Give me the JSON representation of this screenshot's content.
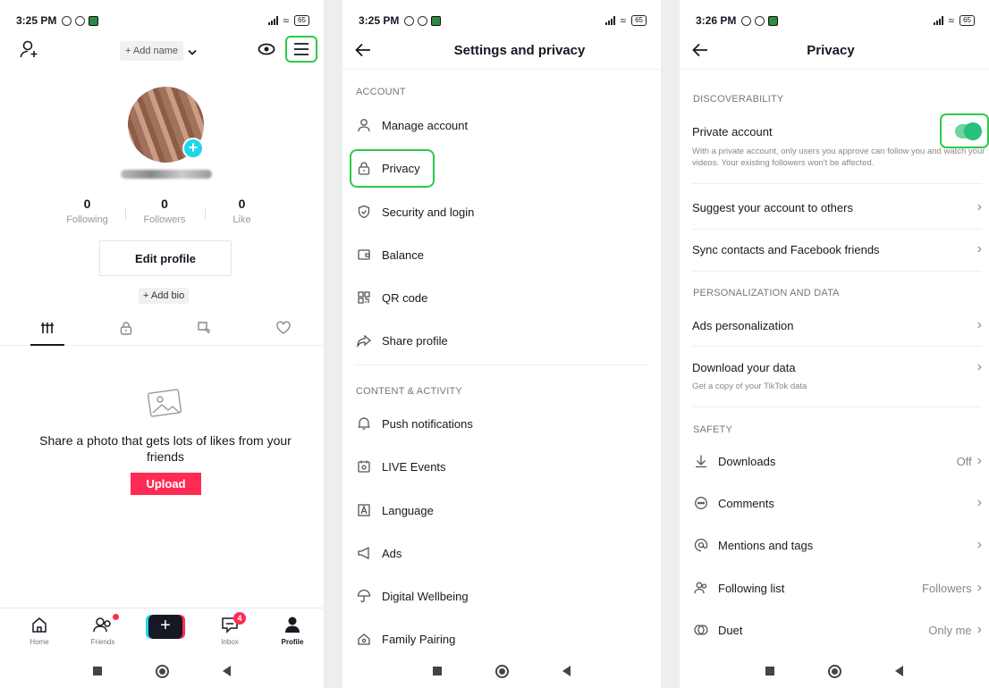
{
  "panel1": {
    "status": {
      "time": "3:25 PM",
      "battery": "65"
    },
    "add_name_label": "+ Add name",
    "stats": [
      {
        "value": "0",
        "label": "Following"
      },
      {
        "value": "0",
        "label": "Followers"
      },
      {
        "value": "0",
        "label": "Like"
      }
    ],
    "edit_profile_label": "Edit profile",
    "add_bio_label": "+ Add bio",
    "empty_state_text": "Share a photo that gets lots of likes from your friends",
    "upload_label": "Upload",
    "nav": {
      "home": "Home",
      "friends": "Friends",
      "inbox": "Inbox",
      "inbox_badge": "4",
      "profile": "Profile",
      "create": "+"
    }
  },
  "panel2": {
    "status": {
      "time": "3:25 PM",
      "battery": "65"
    },
    "title": "Settings and privacy",
    "section_account": "ACCOUNT",
    "account_items": [
      "Manage account",
      "Privacy",
      "Security and login",
      "Balance",
      "QR code",
      "Share profile"
    ],
    "section_content": "CONTENT & ACTIVITY",
    "content_items": [
      "Push notifications",
      "LIVE Events",
      "Language",
      "Ads",
      "Digital Wellbeing",
      "Family Pairing"
    ]
  },
  "panel3": {
    "status": {
      "time": "3:26 PM",
      "battery": "65"
    },
    "title": "Privacy",
    "section_discoverability": "DISCOVERABILITY",
    "private_account_label": "Private account",
    "private_account_desc": "With a private account, only users you approve can follow you and watch your videos. Your existing followers won't be affected.",
    "private_account_on": true,
    "suggest_label": "Suggest your account to others",
    "sync_label": "Sync contacts and Facebook friends",
    "section_personalization": "PERSONALIZATION AND DATA",
    "ads_label": "Ads personalization",
    "download_label": "Download your data",
    "download_desc": "Get a copy of your TikTok data",
    "section_safety": "SAFETY",
    "safety_items": [
      {
        "label": "Downloads",
        "value": "Off"
      },
      {
        "label": "Comments",
        "value": ""
      },
      {
        "label": "Mentions and tags",
        "value": ""
      },
      {
        "label": "Following list",
        "value": "Followers"
      },
      {
        "label": "Duet",
        "value": "Only me"
      }
    ]
  },
  "colors": {
    "accent_red": "#fe2c55",
    "accent_cyan": "#20d5ec",
    "highlight_green": "#2ec94a",
    "toggle_green": "#25c07a"
  }
}
